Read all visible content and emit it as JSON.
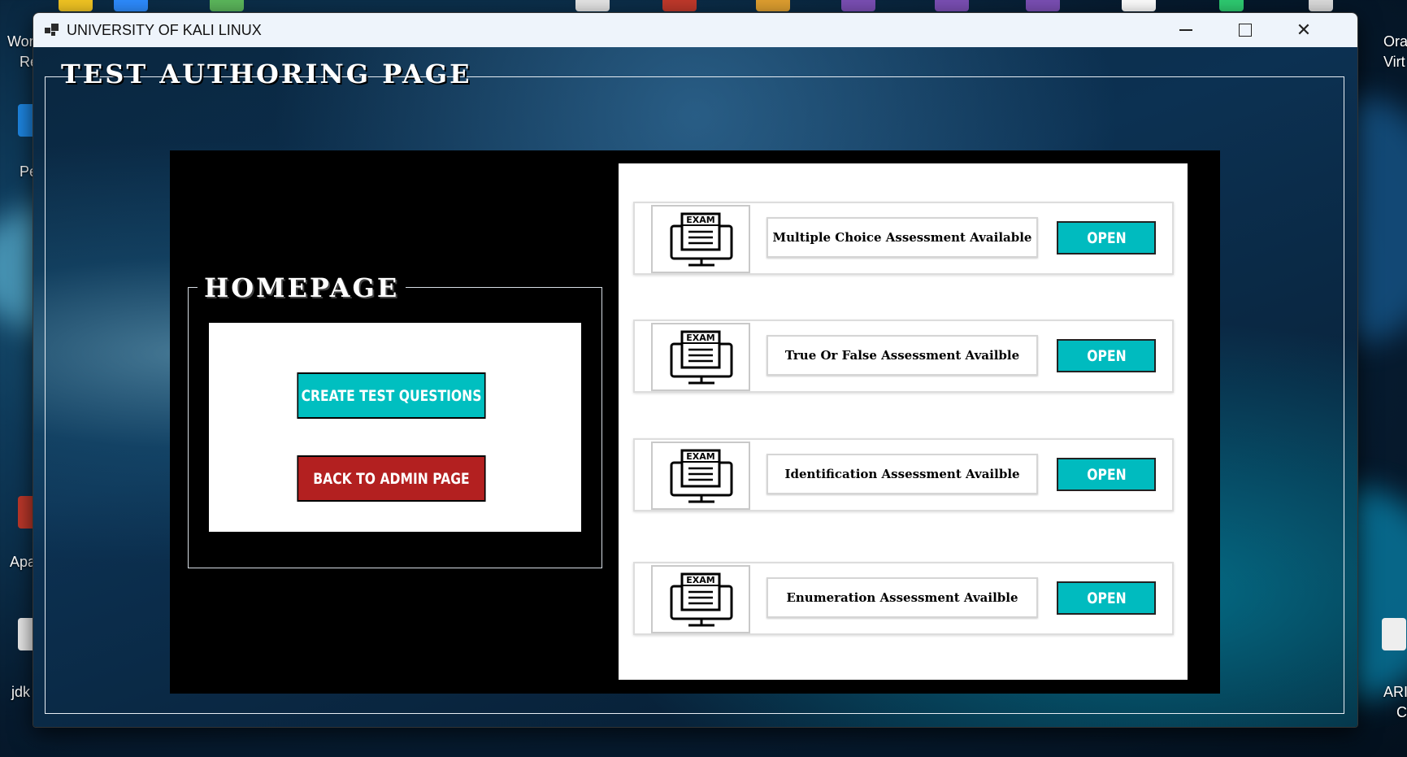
{
  "desktop": {
    "left_labels": [
      "Wor",
      "Re",
      "Pe",
      "Apa",
      "jdk"
    ],
    "right_labels": [
      "Ora",
      "Virt",
      "ARI",
      "C"
    ]
  },
  "window": {
    "title": "UNIVERSITY OF KALI LINUX",
    "controls": {
      "minimize": "minimize",
      "maximize": "maximize",
      "close": "✕"
    }
  },
  "page": {
    "title": "TEST AUTHORING PAGE"
  },
  "homepage": {
    "title": "HOMEPAGE",
    "create_button": "CREATE TEST QUESTIONS",
    "back_button": "BACK TO ADMIN PAGE",
    "colors": {
      "create": "#00bfc0",
      "back": "#b32020"
    }
  },
  "assessments": [
    {
      "icon_text": "EXAM",
      "label": "Multiple Choice Assessment Available",
      "button": "OPEN"
    },
    {
      "icon_text": "EXAM",
      "label": "True Or False Assessment Availble",
      "button": "OPEN"
    },
    {
      "icon_text": "EXAM",
      "label": "Identification Assessment Availble",
      "button": "OPEN"
    },
    {
      "icon_text": "EXAM",
      "label": "Enumeration Assessment Availble",
      "button": "OPEN"
    }
  ]
}
